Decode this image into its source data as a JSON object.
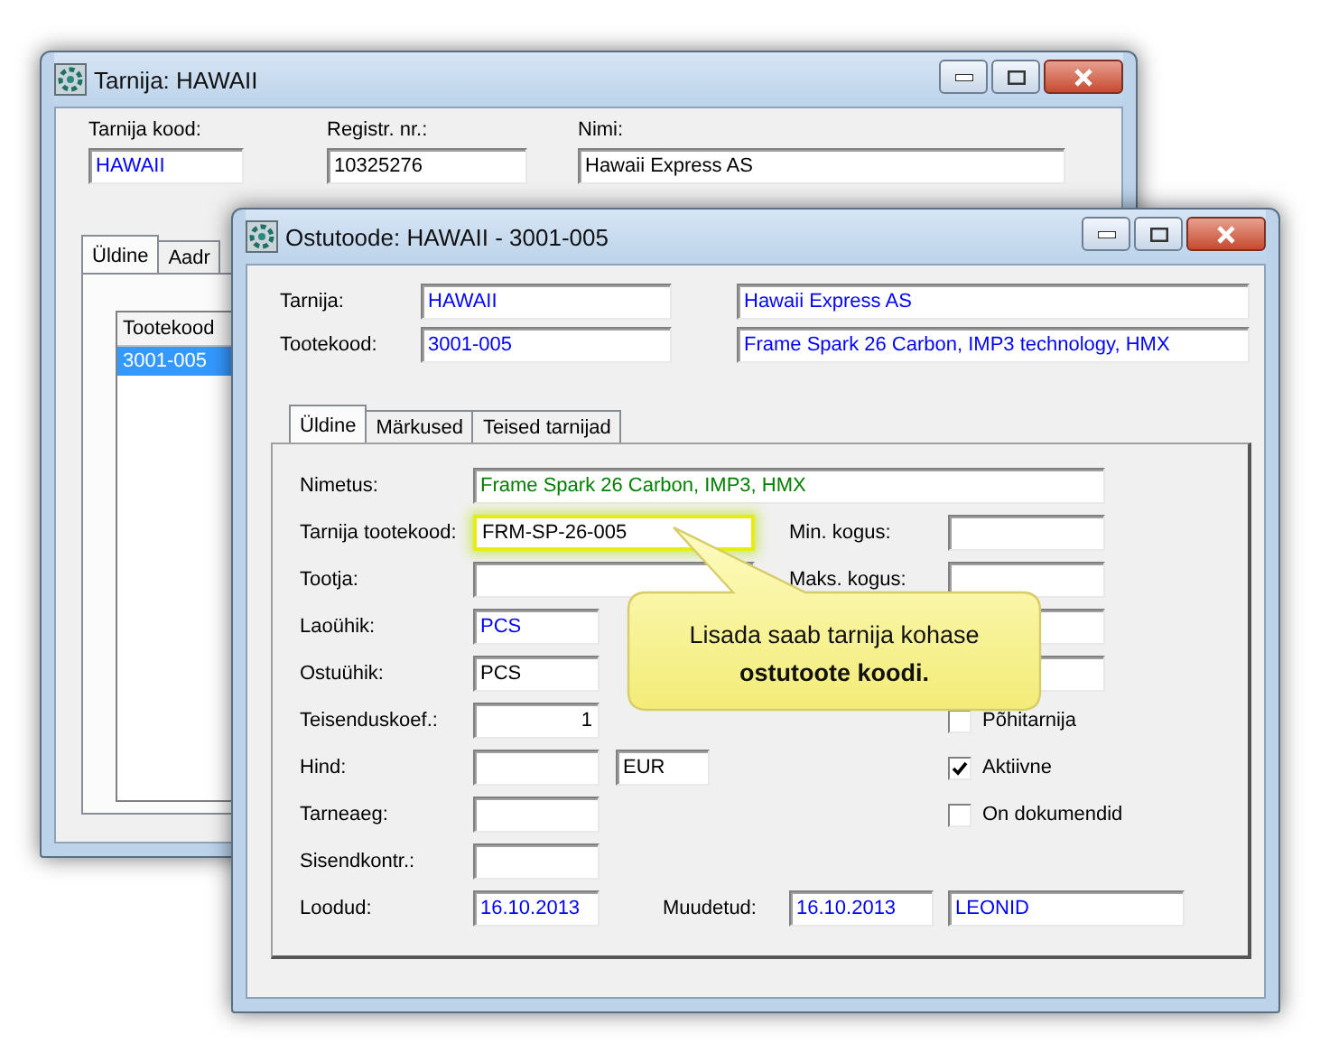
{
  "back_window": {
    "title": "Tarnija: HAWAII",
    "fields": [
      {
        "label": "Tarnija kood:",
        "value": "HAWAII",
        "color": "#0000ff"
      },
      {
        "label": "Registr. nr.:",
        "value": "10325276",
        "color": "#000000"
      },
      {
        "label": "Nimi:",
        "value": "Hawaii Express AS",
        "color": "#000000"
      }
    ],
    "tabs": [
      {
        "label": "Üldine",
        "selected": true
      },
      {
        "label": "Aadr",
        "selected": false
      }
    ],
    "list": {
      "column": "Tootekood",
      "rows": [
        {
          "value": "3001-005",
          "selected": true
        }
      ]
    }
  },
  "front_window": {
    "title": "Ostutoode: HAWAII - 3001-005",
    "header": [
      {
        "label": "Tarnija:",
        "code": {
          "value": "HAWAII",
          "color": "#0000ff"
        },
        "name": {
          "value": "Hawaii Express AS",
          "color": "#0000ff"
        }
      },
      {
        "label": "Tootekood:",
        "code": {
          "value": "3001-005",
          "color": "#0000ff"
        },
        "name": {
          "value": "Frame Spark 26 Carbon, IMP3 technology, HMX",
          "color": "#0000ff"
        }
      }
    ],
    "tabs": [
      {
        "label": "Üldine",
        "selected": true
      },
      {
        "label": "Märkused",
        "selected": false
      },
      {
        "label": "Teised tarnijad",
        "selected": false
      }
    ],
    "rows": [
      {
        "label": "Nimetus:",
        "kind": "wide",
        "fields": [
          {
            "value": "Frame Spark 26 Carbon, IMP3, HMX",
            "color": "#008000"
          }
        ]
      },
      {
        "label": "Tarnija tootekood:",
        "kind": "medium",
        "fields": [
          {
            "value": "FRM-SP-26-005",
            "color": "#000000",
            "highlighted": true
          }
        ],
        "right": {
          "kind": "field",
          "label": "Min. kogus:"
        }
      },
      {
        "label": "Tootja:",
        "kind": "medium",
        "fields": [
          {
            "kind": "blank"
          }
        ],
        "right": {
          "kind": "field",
          "label": "Maks. kogus:"
        }
      },
      {
        "label": "Laoühik:",
        "kind": "short",
        "fields": [
          {
            "value": "PCS",
            "color": "#0000ff"
          }
        ],
        "right": {
          "kind": "field"
        }
      },
      {
        "label": "Ostuühik:",
        "kind": "short",
        "fields": [
          {
            "value": "PCS",
            "color": "#000000"
          }
        ],
        "right": {
          "kind": "field"
        }
      },
      {
        "label": "Teisenduskoef.:",
        "kind": "number",
        "fields": [
          {
            "value": "1",
            "color": "#000000"
          }
        ],
        "right": {
          "kind": "checkbox",
          "label": "Põhitarnija",
          "checked": false
        }
      },
      {
        "label": "Hind:",
        "kind": "short",
        "fields": [
          {
            "kind": "blank"
          },
          {
            "value": "EUR",
            "color": "#000000"
          }
        ],
        "right": {
          "kind": "checkbox",
          "label": "Aktiivne",
          "checked": true
        }
      },
      {
        "label": "Tarneaeg:",
        "kind": "short",
        "fields": [
          {
            "kind": "blank"
          }
        ],
        "right": {
          "kind": "checkbox",
          "label": "On dokumendid",
          "checked": false
        }
      },
      {
        "label": "Sisendkontr.:",
        "kind": "short",
        "fields": [
          {
            "kind": "blank"
          }
        ]
      },
      {
        "label": "Loodud:",
        "kind": "short",
        "fields": [
          {
            "value": "16.10.2013",
            "color": "#0000ff"
          }
        ],
        "extra": {
          "label": "Muudetud:",
          "fields": [
            {
              "value": "16.10.2013",
              "color": "#0000ff"
            },
            {
              "value": "LEONID",
              "color": "#0000ff"
            }
          ]
        }
      }
    ]
  },
  "callout": {
    "text": "Lisada saab tarnija kohase **ostutoote koodi.**"
  }
}
